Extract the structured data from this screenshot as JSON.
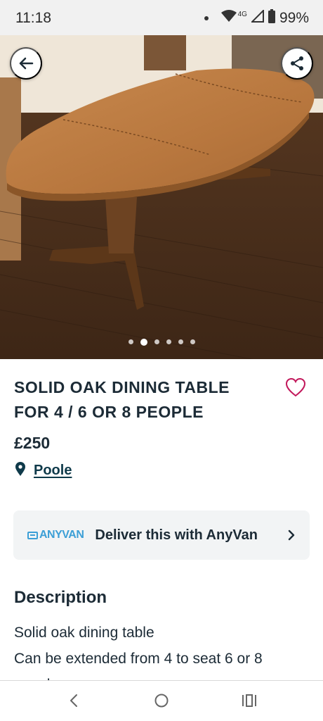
{
  "status_bar": {
    "time": "11:18",
    "network": "4G",
    "battery": "99%"
  },
  "listing": {
    "image_count": 6,
    "active_image_index": 1,
    "title": "SOLID OAK DINING TABLE FOR 4 / 6 OR 8 PEOPLE",
    "price": "£250",
    "location": "Poole"
  },
  "delivery": {
    "logo_text": "ANYVAN",
    "label": "Deliver this with AnyVan"
  },
  "description": {
    "heading": "Description",
    "lines": [
      "Solid oak dining table",
      "Can be extended from 4 to seat 6 or 8",
      "people"
    ]
  },
  "icons": {
    "back": "arrow-left-icon",
    "share": "share-icon",
    "favourite": "heart-outline-icon",
    "location": "map-pin-icon",
    "delivery_chevron": "chevron-right-icon"
  },
  "colors": {
    "text_primary": "#1c2b36",
    "link": "#0f3a4a",
    "anyvan_blue": "#3c9fd6",
    "favourite_pink": "#c2185b",
    "card_background": "#f2f4f5"
  }
}
